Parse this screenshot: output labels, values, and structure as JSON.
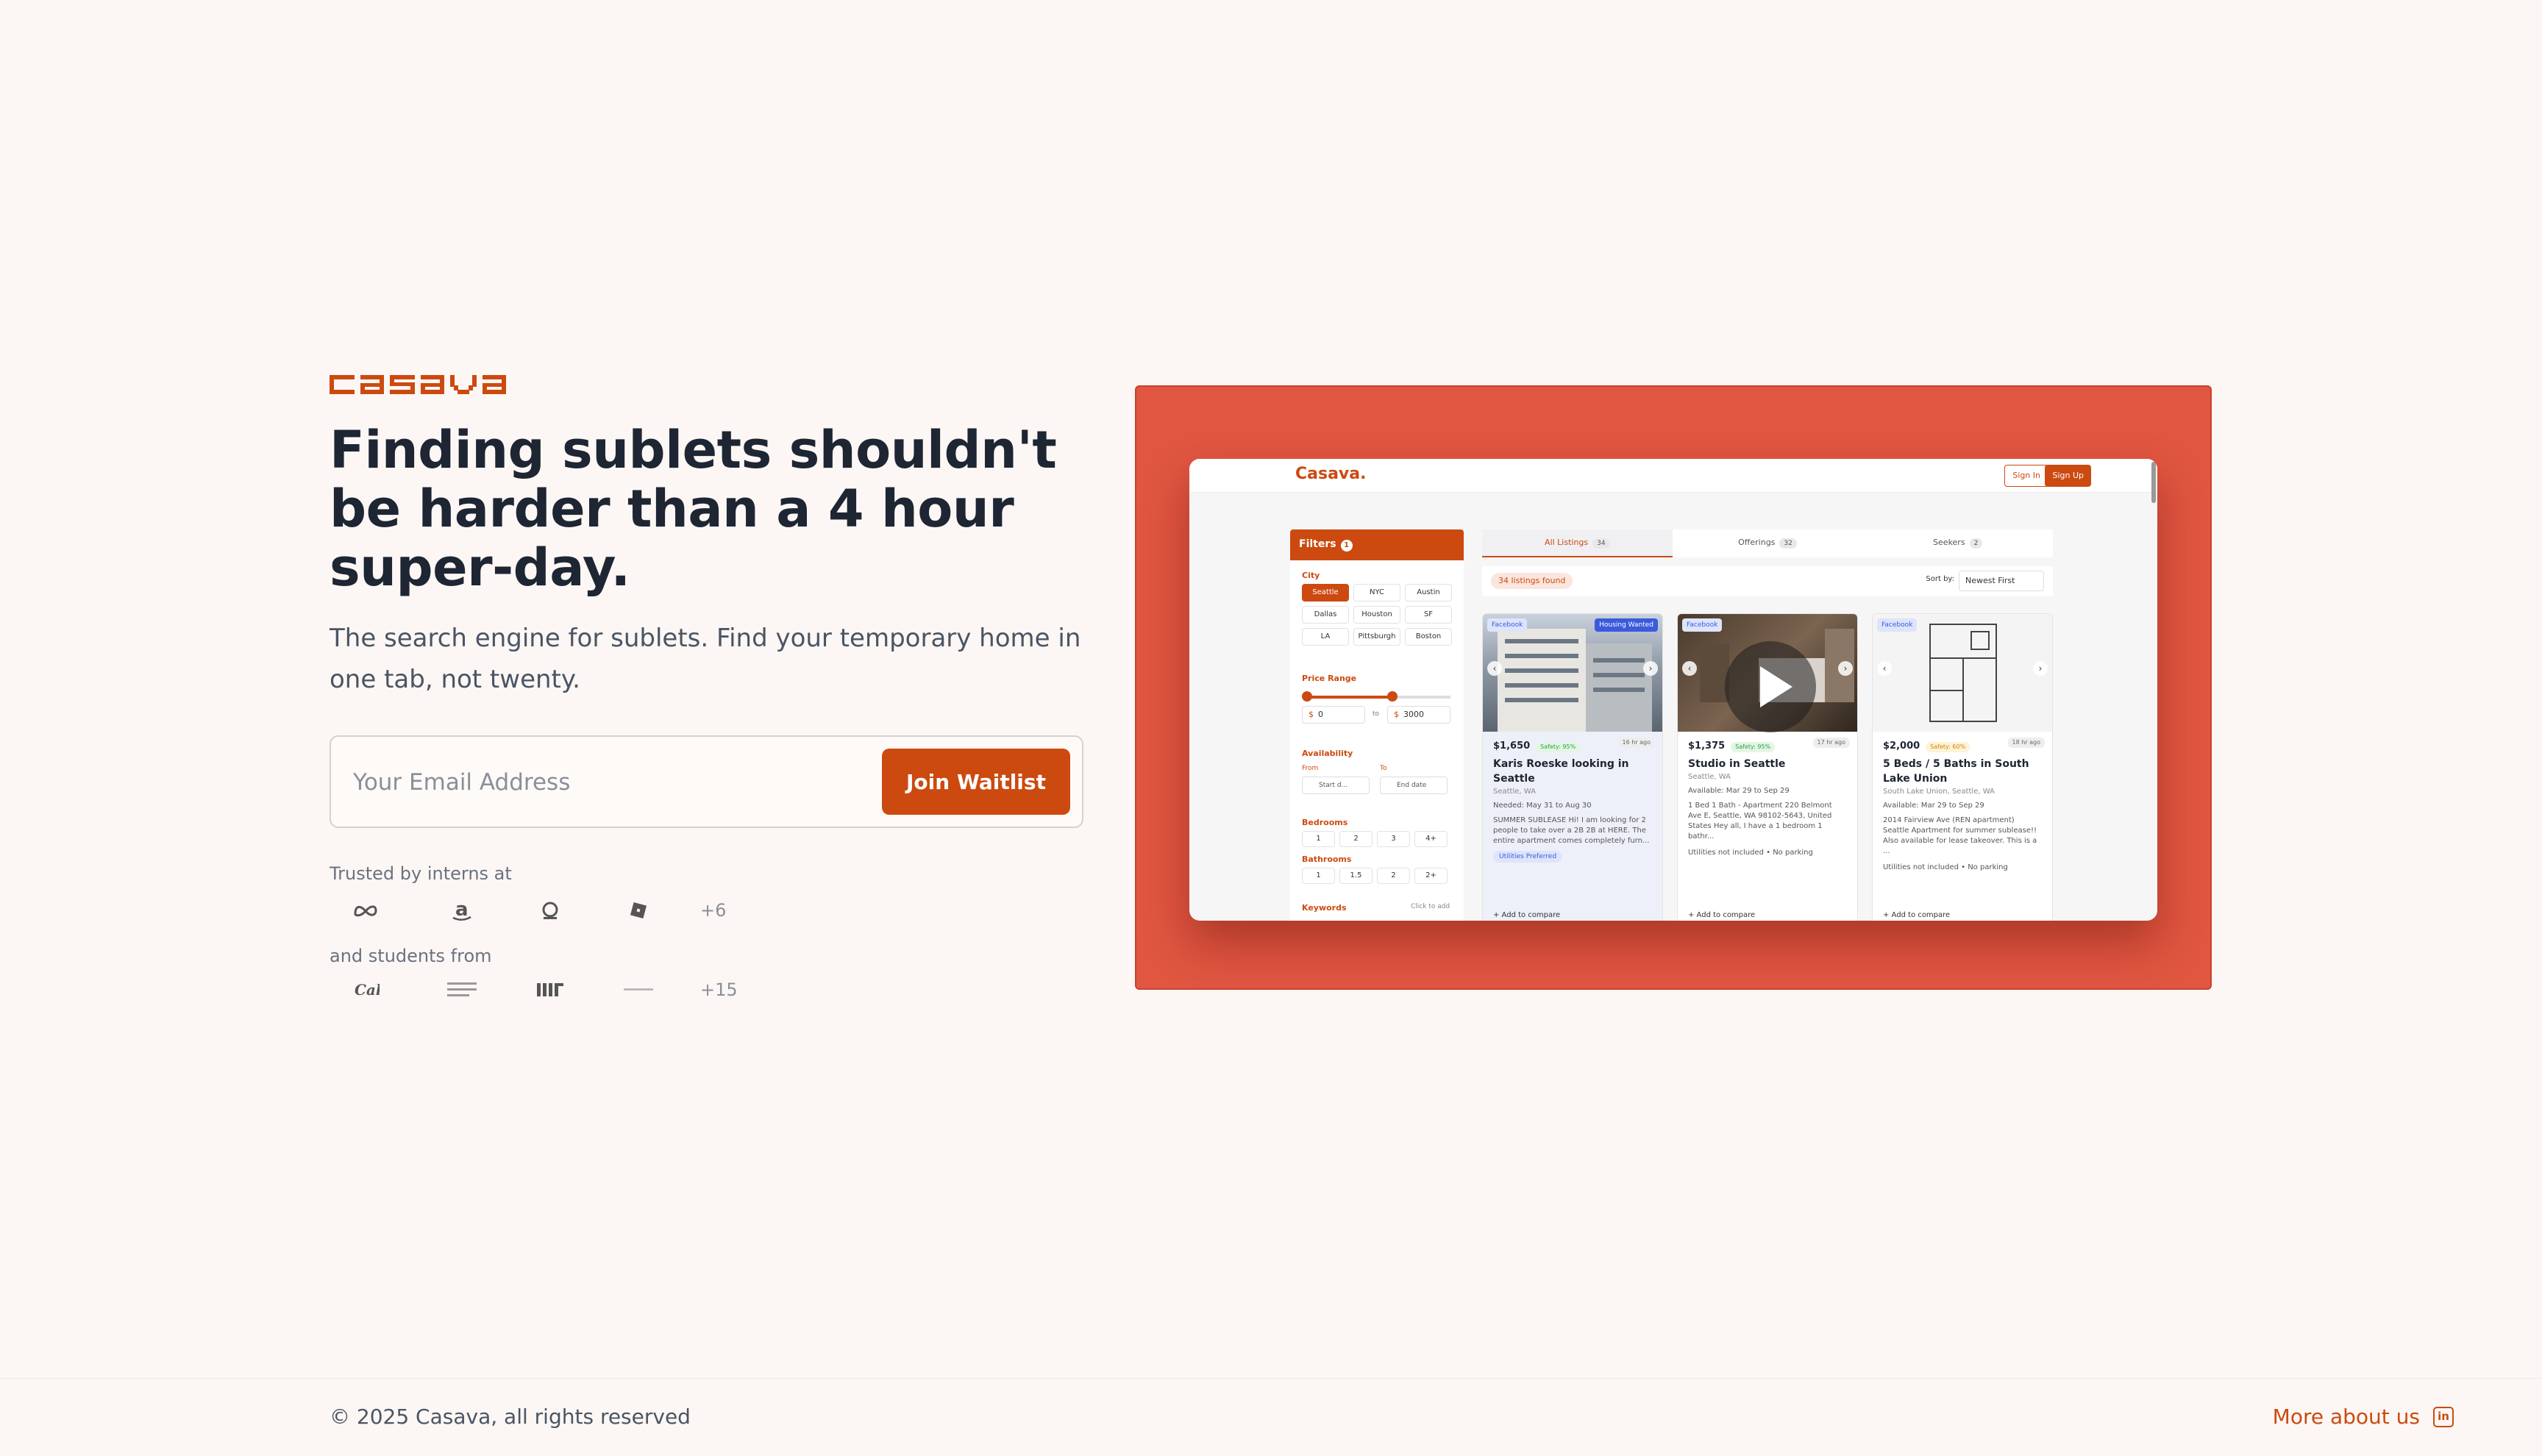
{
  "brand": {
    "logo_text": "casava",
    "color": "#cc4a10"
  },
  "hero": {
    "headline": "Finding sublets shouldn't be harder than a 4 hour super-day.",
    "subhead": "The search engine for sublets. Find your temporary home in one tab, not twenty."
  },
  "waitlist": {
    "email_placeholder": "Your Email Address",
    "email_value": "",
    "button_label": "Join Waitlist"
  },
  "trust": {
    "interns_label": "Trusted by interns at",
    "intern_logos": [
      "meta-logo-icon",
      "amazon-logo-icon",
      "openai-logo-icon",
      "roblox-logo-icon"
    ],
    "interns_more": "+6",
    "students_label": "and students from",
    "student_logos": [
      "cal-logo-icon",
      "cmu-logo-icon",
      "mit-logo-icon",
      "upenn-logo-icon"
    ],
    "students_more": "+15"
  },
  "showcase": {
    "background": "#e05641",
    "app": {
      "brand": "Casava.",
      "sign_in": "Sign In",
      "sign_up": "Sign Up",
      "filters": {
        "title": "Filters",
        "count": "1",
        "city_label": "City",
        "cities": [
          "Seattle",
          "NYC",
          "Austin",
          "Dallas",
          "Houston",
          "SF",
          "LA",
          "Pittsburgh",
          "Boston"
        ],
        "selected_city": "Seattle",
        "price_label": "Price Range",
        "price_min": "0",
        "price_max": "3000",
        "price_to": "to",
        "currency": "$",
        "availability_label": "Availability",
        "from_label": "From",
        "to_label": "To",
        "from_placeholder": "Start d...",
        "to_placeholder": "End date",
        "bedrooms_label": "Bedrooms",
        "bedrooms": [
          "1",
          "2",
          "3",
          "4+"
        ],
        "bathrooms_label": "Bathrooms",
        "bathrooms": [
          "1",
          "1.5",
          "2",
          "2+"
        ],
        "keywords_label": "Keywords",
        "keywords_hint": "Click to add"
      },
      "tabs": [
        {
          "label": "All Listings",
          "count": "34",
          "active": true
        },
        {
          "label": "Offerings",
          "count": "32",
          "active": false
        },
        {
          "label": "Seekers",
          "count": "2",
          "active": false
        }
      ],
      "results_found": "34 listings found",
      "sort_label": "Sort by:",
      "sort_value": "Newest First",
      "listings": [
        {
          "tag_left": "Facebook",
          "tag_right": "Housing Wanted",
          "price": "$1,650",
          "safety": "Safety: 95%",
          "ago": "16 hr ago",
          "title": "Karis Roeske looking in Seattle",
          "location": "Seattle, WA",
          "dates": "Needed: May 31 to Aug 30",
          "desc": "SUMMER SUBLEASE Hi! I am looking for 2 people to take over a 2B 2B at HERE. The entire apartment comes completely furn...",
          "pill": "Utilities Preferred",
          "compare": "+ Add to compare"
        },
        {
          "tag_left": "Facebook",
          "tag_right": "",
          "price": "$1,375",
          "safety": "Safety: 95%",
          "ago": "17 hr ago",
          "title": "Studio in Seattle",
          "location": "Seattle, WA",
          "dates": "Available: Mar 29 to Sep 29",
          "desc": "1 Bed 1 Bath - Apartment 220 Belmont Ave E, Seattle, WA 98102-5643, United States Hey all, I have a 1 bedroom 1 bathr...",
          "pill": "Utilities not included • No parking",
          "compare": "+ Add to compare"
        },
        {
          "tag_left": "Facebook",
          "tag_right": "",
          "price": "$2,000",
          "safety": "Safety: 60%",
          "ago": "18 hr ago",
          "title": "5 Beds / 5 Baths in South Lake Union",
          "location": "South Lake Union, Seattle, WA",
          "dates": "Available: Mar 29 to Sep 29",
          "desc": "2014 Fairview Ave (REN apartment) Seattle Apartment for summer sublease!! Also available for lease takeover. This is a ...",
          "pill": "Utilities not included • No parking",
          "compare": "+ Add to compare"
        }
      ]
    }
  },
  "footer": {
    "copyright": "© 2025 Casava, all rights reserved",
    "more_link": "More about us",
    "linkedin_glyph": "in"
  }
}
